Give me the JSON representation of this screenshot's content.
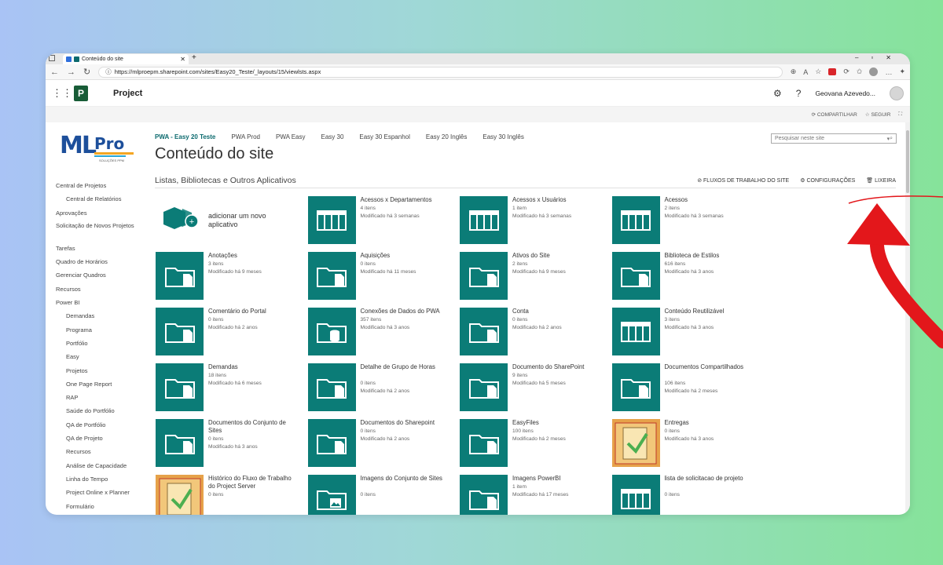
{
  "browser": {
    "tab_title": "Conteúdo do site",
    "url": "https://mlproepm.sharepoint.com/sites/Easy20_Teste/_layouts/15/viewlsts.aspx"
  },
  "suite": {
    "app_name": "Project",
    "user_name": "Geovana Azevedo..."
  },
  "actions": {
    "share": "COMPARTILHAR",
    "follow": "SEGUIR"
  },
  "top_nav": [
    "PWA - Easy 20 Teste",
    "PWA Prod",
    "PWA Easy",
    "Easy 30",
    "Easy 30 Espanhol",
    "Easy 20 Inglês",
    "Easy 30 Inglês"
  ],
  "search_placeholder": "Pesquisar neste site",
  "page_title": "Conteúdo do site",
  "logo": {
    "text1": "ML",
    "text2": "Pro",
    "sub": "SOLUÇÕES PPM"
  },
  "side_nav": [
    {
      "label": "Central de Projetos",
      "sub": false
    },
    {
      "label": "Central de Relatórios",
      "sub": true
    },
    {
      "label": "Aprovações",
      "sub": false
    },
    {
      "label": "Solicitação de Novos Projetos",
      "sub": false
    },
    {
      "label": "Tarefas",
      "sub": false
    },
    {
      "label": "Quadro de Horários",
      "sub": false
    },
    {
      "label": "Gerenciar Quadros",
      "sub": false
    },
    {
      "label": "Recursos",
      "sub": false
    },
    {
      "label": "Power BI",
      "sub": false
    },
    {
      "label": "Demandas",
      "sub": true
    },
    {
      "label": "Programa",
      "sub": true
    },
    {
      "label": "Portfólio",
      "sub": true
    },
    {
      "label": "Easy",
      "sub": true
    },
    {
      "label": "Projetos",
      "sub": true
    },
    {
      "label": "One Page Report",
      "sub": true
    },
    {
      "label": "RAP",
      "sub": true
    },
    {
      "label": "Saúde do Portfólio",
      "sub": true
    },
    {
      "label": "QA de Portfólio",
      "sub": true
    },
    {
      "label": "QA de Projeto",
      "sub": true
    },
    {
      "label": "Recursos",
      "sub": true
    },
    {
      "label": "Análise de Capacidade",
      "sub": true
    },
    {
      "label": "Linha do Tempo",
      "sub": true
    },
    {
      "label": "Project Online x Planner",
      "sub": true
    },
    {
      "label": "Formulário",
      "sub": true
    }
  ],
  "section": {
    "title": "Listas, Bibliotecas e Outros Aplicativos",
    "workflows": "FLUXOS DE TRABALHO DO SITE",
    "settings": "CONFIGURAÇÕES",
    "trash": "LIXEIRA"
  },
  "add_app": "adicionar um novo aplicativo",
  "tiles": [
    {
      "name": "Acessos x Departamentos",
      "count": "4 itens",
      "modified": "Modificado há 3 semanas",
      "icon": "list"
    },
    {
      "name": "Acessos x Usuários",
      "count": "1 item",
      "modified": "Modificado há 3 semanas",
      "icon": "list"
    },
    {
      "name": "Acessos",
      "count": "2 itens",
      "modified": "Modificado há 3 semanas",
      "icon": "list"
    },
    {
      "name": "Anotações",
      "count": "3 itens",
      "modified": "Modificado há 9 meses",
      "icon": "library"
    },
    {
      "name": "Aquisições",
      "count": "0 itens",
      "modified": "Modificado há 11 meses",
      "icon": "library"
    },
    {
      "name": "Ativos do Site",
      "count": "2 itens",
      "modified": "Modificado há 9 meses",
      "icon": "library"
    },
    {
      "name": "Biblioteca de Estilos",
      "count": "616 itens",
      "modified": "Modificado há 3 anos",
      "icon": "library"
    },
    {
      "name": "Comentário do Portal",
      "count": "0 itens",
      "modified": "Modificado há 2 anos",
      "icon": "library"
    },
    {
      "name": "Conexões de Dados do PWA",
      "count": "357 itens",
      "modified": "Modificado há 3 anos",
      "icon": "dataconn"
    },
    {
      "name": "Conta",
      "count": "0 itens",
      "modified": "Modificado há 2 anos",
      "icon": "library"
    },
    {
      "name": "Conteúdo Reutilizável",
      "count": "3 itens",
      "modified": "Modificado há 3 anos",
      "icon": "list"
    },
    {
      "name": "Demandas",
      "count": "18 itens",
      "modified": "Modificado há 6 meses",
      "icon": "library"
    },
    {
      "name": "Detalhe de Grupo de Horas",
      "count": "0 itens",
      "modified": "Modificado há 2 anos",
      "icon": "library"
    },
    {
      "name": "Documento do SharePoint",
      "count": "9 itens",
      "modified": "Modificado há 5 meses",
      "icon": "library"
    },
    {
      "name": "Documentos Compartilhados",
      "count": "106 itens",
      "modified": "Modificado há 2 meses",
      "icon": "library"
    },
    {
      "name": "Documentos do Conjunto de Sites",
      "count": "0 itens",
      "modified": "Modificado há 3 anos",
      "icon": "library"
    },
    {
      "name": "Documentos do Sharepoint",
      "count": "0 itens",
      "modified": "Modificado há 2 anos",
      "icon": "library"
    },
    {
      "name": "EasyFiles",
      "count": "100 itens",
      "modified": "Modificado há 2 meses",
      "icon": "library"
    },
    {
      "name": "Entregas",
      "count": "0 itens",
      "modified": "Modificado há 3 anos",
      "icon": "legacy"
    },
    {
      "name": "Histórico do Fluxo de Trabalho do Project Server",
      "count": "0 itens",
      "modified": "",
      "icon": "legacy"
    },
    {
      "name": "Imagens do Conjunto de Sites",
      "count": "0 itens",
      "modified": "",
      "icon": "image"
    },
    {
      "name": "Imagens PowerBI",
      "count": "1 item",
      "modified": "Modificado há 17 meses",
      "icon": "library"
    },
    {
      "name": "lista de solicitacao de projeto",
      "count": "0 itens",
      "modified": "",
      "icon": "list"
    }
  ],
  "colors": {
    "tile": "#0b7c77",
    "accent": "#0b6a6e",
    "arrow": "#e3171b"
  }
}
